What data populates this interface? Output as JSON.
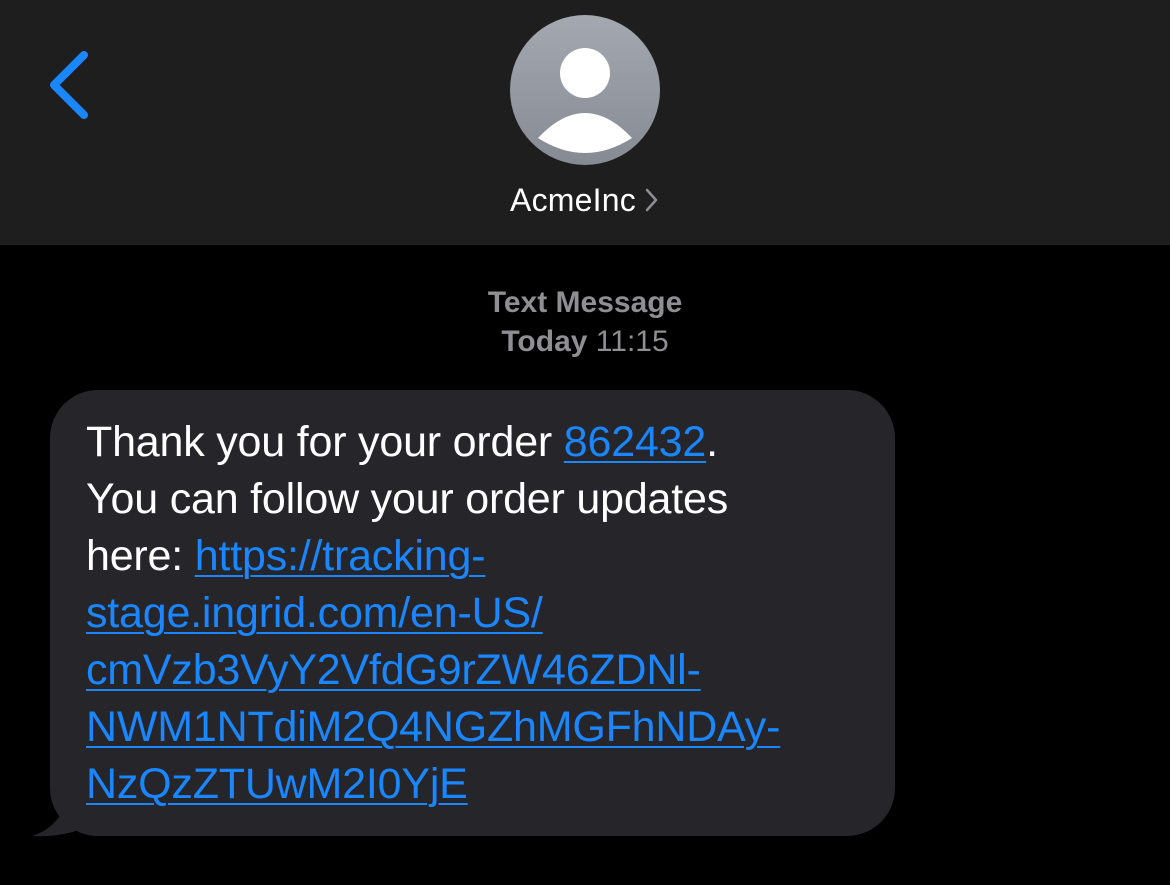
{
  "header": {
    "contact_name": "AcmeInc"
  },
  "conversation": {
    "service_label": "Text Message",
    "day_label": "Today",
    "time_label": "11:15"
  },
  "message": {
    "line1_prefix": "Thank you for your order ",
    "order_number": "862432",
    "line1_suffix": ".",
    "line2": "You can follow your order updates",
    "line3_prefix": "here: ",
    "url_line1": "https://tracking-",
    "url_line2": "stage.ingrid.com/en-US/",
    "url_line3": "cmVzb3VyY2VfdG9rZW46ZDNl-",
    "url_line4": "NWM1NTdiM2Q4NGZhMGFhNDAy-",
    "url_line5": "NzQzZTUwM2I0YjE"
  },
  "colors": {
    "accent_link": "#1a86ff",
    "header_bg": "#1e1e1e",
    "bubble_bg": "#26252a",
    "meta_text": "#8e8e93"
  },
  "icons": {
    "back": "chevron-left-icon",
    "avatar": "person-silhouette-icon",
    "details": "chevron-right-icon"
  }
}
